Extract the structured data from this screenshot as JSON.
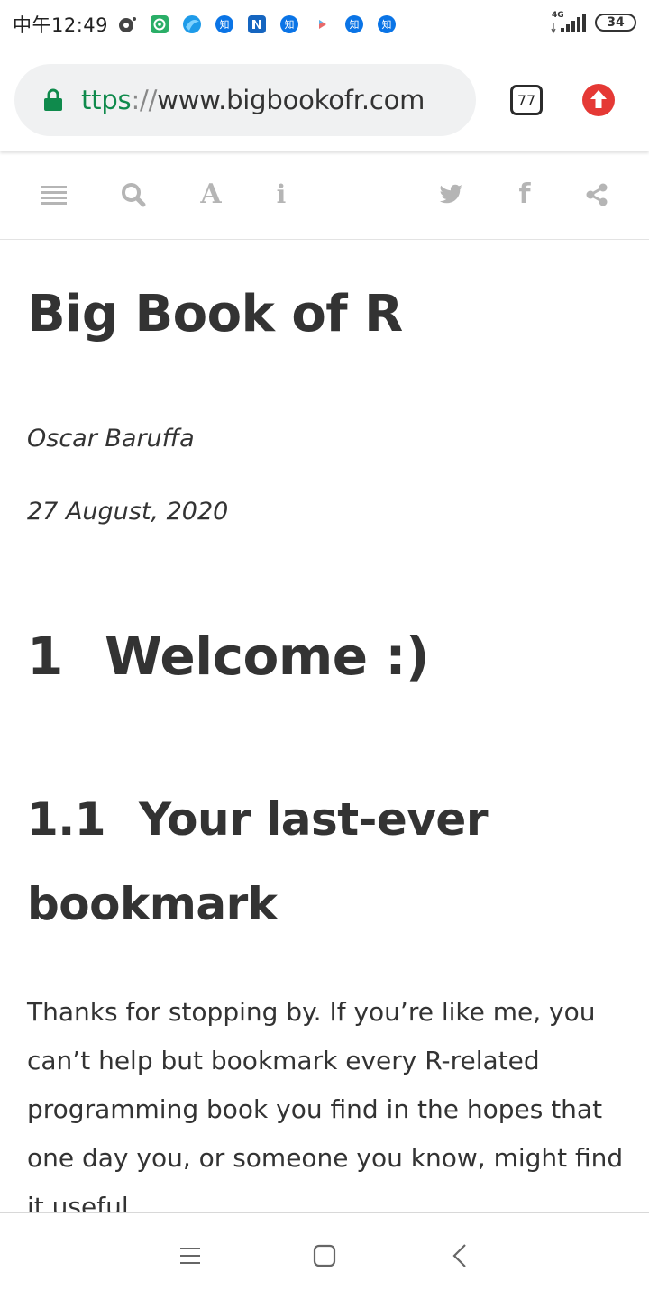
{
  "status_bar": {
    "time": "中午12:49",
    "network": "4G",
    "battery": "34",
    "notification_icons": [
      "record-icon",
      "wechat-pay-icon",
      "browser-icon",
      "zhihu-icon",
      "nav-app-icon",
      "zhihu-icon",
      "play-icon",
      "zhihu-icon",
      "zhihu-icon"
    ],
    "zhihu_glyph": "知"
  },
  "browser": {
    "url_scheme": "ttps",
    "url_sep": "://",
    "url_host": "www.bigbookofr.com",
    "tab_count": "77",
    "accent_secure": "#0f8a4c",
    "upload_color": "#e53935"
  },
  "book_toolbar": {
    "font_glyph": "A",
    "info_glyph": "i",
    "facebook_glyph": "f",
    "icon_color": "#b5b5b5"
  },
  "content": {
    "title": "Big Book of R",
    "author": "Oscar Baruffa",
    "date": "27 August, 2020",
    "chapter_number": "1",
    "chapter_title": "Welcome :)",
    "section_number": "1.1",
    "section_title": "Your last-ever bookmark",
    "paragraph": "Thanks for stopping by. If you’re like me, you can’t help but bookmark every R-related programming book you find in the hopes that one day you, or someone you know, might find it useful."
  }
}
